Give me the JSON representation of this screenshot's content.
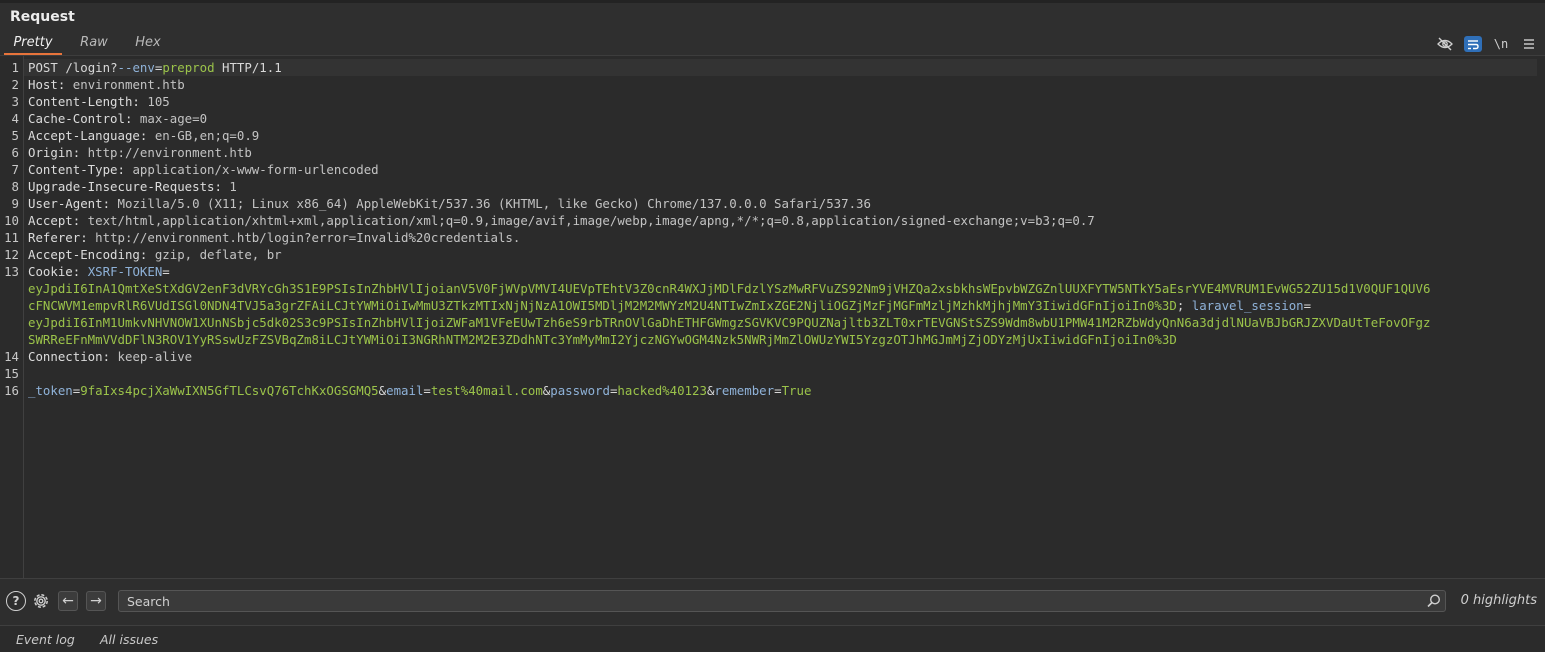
{
  "panel": {
    "title": "Request"
  },
  "tabs": [
    {
      "label": "Pretty",
      "active": true
    },
    {
      "label": "Raw",
      "active": false
    },
    {
      "label": "Hex",
      "active": false
    }
  ],
  "toolbar": {
    "icons": [
      "hide-eye-icon",
      "wrap-lines-icon",
      "newline-icon",
      "menu-icon"
    ],
    "newline_label": "\\n"
  },
  "request_lines": [
    {
      "n": "1",
      "segments": [
        {
          "t": "POST ",
          "c": "plain"
        },
        {
          "t": "/login?",
          "c": "plain"
        },
        {
          "t": "--env",
          "c": "blue"
        },
        {
          "t": "=",
          "c": "plain"
        },
        {
          "t": "preprod",
          "c": "green"
        },
        {
          "t": " HTTP/1.1",
          "c": "plain"
        }
      ]
    },
    {
      "n": "2",
      "segments": [
        {
          "t": "Host:",
          "c": "hdr-name"
        },
        {
          "t": " environment.htb",
          "c": "hdr-val"
        }
      ]
    },
    {
      "n": "3",
      "segments": [
        {
          "t": "Content-Length:",
          "c": "hdr-name"
        },
        {
          "t": " 105",
          "c": "hdr-val"
        }
      ]
    },
    {
      "n": "4",
      "segments": [
        {
          "t": "Cache-Control:",
          "c": "hdr-name"
        },
        {
          "t": " max-age=0",
          "c": "hdr-val"
        }
      ]
    },
    {
      "n": "5",
      "segments": [
        {
          "t": "Accept-Language:",
          "c": "hdr-name"
        },
        {
          "t": " en-GB,en;q=0.9",
          "c": "hdr-val"
        }
      ]
    },
    {
      "n": "6",
      "segments": [
        {
          "t": "Origin:",
          "c": "hdr-name"
        },
        {
          "t": " http://environment.htb",
          "c": "hdr-val"
        }
      ]
    },
    {
      "n": "7",
      "segments": [
        {
          "t": "Content-Type:",
          "c": "hdr-name"
        },
        {
          "t": " application/x-www-form-urlencoded",
          "c": "hdr-val"
        }
      ]
    },
    {
      "n": "8",
      "segments": [
        {
          "t": "Upgrade-Insecure-Requests:",
          "c": "hdr-name"
        },
        {
          "t": " 1",
          "c": "hdr-val"
        }
      ]
    },
    {
      "n": "9",
      "segments": [
        {
          "t": "User-Agent:",
          "c": "hdr-name"
        },
        {
          "t": " Mozilla/5.0 (X11; Linux x86_64) AppleWebKit/537.36 (KHTML, like Gecko) Chrome/137.0.0.0 Safari/537.36",
          "c": "hdr-val"
        }
      ]
    },
    {
      "n": "10",
      "segments": [
        {
          "t": "Accept:",
          "c": "hdr-name"
        },
        {
          "t": " text/html,application/xhtml+xml,application/xml;q=0.9,image/avif,image/webp,image/apng,*/*;q=0.8,application/signed-exchange;v=b3;q=0.7",
          "c": "hdr-val"
        }
      ]
    },
    {
      "n": "11",
      "segments": [
        {
          "t": "Referer:",
          "c": "hdr-name"
        },
        {
          "t": " http://environment.htb/login?error=Invalid%20credentials.",
          "c": "hdr-val"
        }
      ]
    },
    {
      "n": "12",
      "segments": [
        {
          "t": "Accept-Encoding:",
          "c": "hdr-name"
        },
        {
          "t": " gzip, deflate, br",
          "c": "hdr-val"
        }
      ]
    },
    {
      "n": "13",
      "segments": [
        {
          "t": "Cookie:",
          "c": "hdr-name"
        },
        {
          "t": " ",
          "c": "plain"
        },
        {
          "t": "XSRF-TOKEN",
          "c": "blue"
        },
        {
          "t": "=",
          "c": "plain"
        }
      ]
    },
    {
      "n": "",
      "segments": [
        {
          "t": "eyJpdiI6InA1QmtXeStXdGV2enF3dVRYcGh3S1E9PSIsInZhbHVlIjoianV5V0FjWVpVMVI4UEVpTEhtV3Z0cnR4WXJjMDlFdzlYSzMwRFVuZS92Nm9jVHZQa2xsbkhsWEpvbWZGZnlUUXFYTW5NTkY5aEsrYVE4MVRUM1EvWG52ZU15d1V0QUF1QUV6",
          "c": "green"
        }
      ]
    },
    {
      "n": "",
      "segments": [
        {
          "t": "cFNCWVM1empvRlR6VUdISGl0NDN4TVJ5a3grZFAiLCJtYWMiOiIwMmU3ZTkzMTIxNjNjNzA1OWI5MDljM2M2MWYzM2U4NTIwZmIxZGE2NjliOGZjMzFjMGFmMzljMzhkMjhjMmY3IiwidGFnIjoiIn0%3D",
          "c": "green"
        },
        {
          "t": "; ",
          "c": "plain"
        },
        {
          "t": "laravel_session",
          "c": "blue"
        },
        {
          "t": "=",
          "c": "plain"
        }
      ]
    },
    {
      "n": "",
      "segments": [
        {
          "t": "eyJpdiI6InM1UmkvNHVNOW1XUnNSbjc5dk02S3c9PSIsInZhbHVlIjoiZWFaM1VFeEUwTzh6eS9rbTRnOVlGaDhETHFGWmgzSGVKVC9PQUZNajltb3ZLT0xrTEVGNStSZS9Wdm8wbU1PMW41M2RZbWdyQnN6a3djdlNUaVBJbGRJZXVDaUtTeFovOFgz",
          "c": "green"
        }
      ]
    },
    {
      "n": "",
      "segments": [
        {
          "t": "SWRReEFnMmVVdDFlN3ROV1YyRSswUzFZSVBqZm8iLCJtYWMiOiI3NGRhNTM2M2E3ZDdhNTc3YmMyMmI2YjczNGYwOGM4Nzk5NWRjMmZlOWUzYWI5YzgzOTJhMGJmMjZjODYzMjUxIiwidGFnIjoiIn0%3D",
          "c": "green"
        }
      ]
    },
    {
      "n": "14",
      "segments": [
        {
          "t": "Connection:",
          "c": "hdr-name"
        },
        {
          "t": " keep-alive",
          "c": "hdr-val"
        }
      ]
    },
    {
      "n": "15",
      "segments": []
    },
    {
      "n": "16",
      "segments": [
        {
          "t": "_token",
          "c": "blue"
        },
        {
          "t": "=",
          "c": "plain"
        },
        {
          "t": "9faIxs4pcjXaWwIXN5GfTLCsvQ76TchKxOGSGMQ5",
          "c": "green"
        },
        {
          "t": "&",
          "c": "plain"
        },
        {
          "t": "email",
          "c": "blue"
        },
        {
          "t": "=",
          "c": "plain"
        },
        {
          "t": "test%40mail.com",
          "c": "green"
        },
        {
          "t": "&",
          "c": "plain"
        },
        {
          "t": "password",
          "c": "blue"
        },
        {
          "t": "=",
          "c": "plain"
        },
        {
          "t": "hacked%40123",
          "c": "green"
        },
        {
          "t": "&",
          "c": "plain"
        },
        {
          "t": "remember",
          "c": "blue"
        },
        {
          "t": "=",
          "c": "plain"
        },
        {
          "t": "True",
          "c": "green"
        }
      ]
    }
  ],
  "search": {
    "placeholder": "Search",
    "highlights": "0 highlights"
  },
  "footer": {
    "event_log": "Event log",
    "all_issues": "All issues"
  },
  "colors": {
    "accent": "#e8743b",
    "toggle_on": "#2f6fb8",
    "value_green": "#9bc34a",
    "key_blue": "#8fb2d8"
  }
}
